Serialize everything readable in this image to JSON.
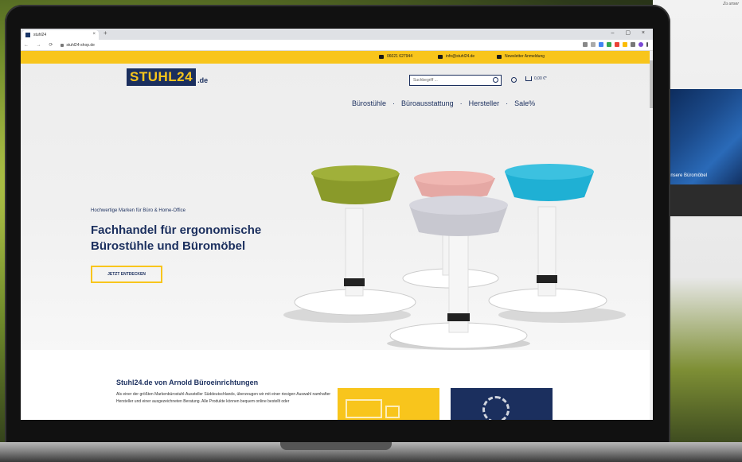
{
  "background": {
    "right_text": "Zu unser",
    "right_caption": "Unsere Büromöbel"
  },
  "browser": {
    "tab_title": "stuhl24",
    "url": "stuhl24-shop.de"
  },
  "topbar": {
    "phone": "06021 627944",
    "email": "info@stuhl24.de",
    "newsletter": "Newsletter Anmeldung"
  },
  "header": {
    "logo_main": "STUHL24",
    "logo_tld": ".de",
    "search_placeholder": "Suchbegriff ...",
    "cart_total": "0,00 €*"
  },
  "nav": {
    "items": [
      "Bürostühle",
      "Büroausstattung",
      "Hersteller",
      "Sale%"
    ]
  },
  "hero": {
    "kicker": "Hochwertige Marken für Büro & Home-Office",
    "headline": "Fachhandel für ergonomische Bürostühle und Büromöbel",
    "cta": "JETZT ENTDECKEN"
  },
  "content": {
    "title": "Stuhl24.de von Arnold Büroeinrichtungen",
    "text": "Als einer der größten Markenbürostuhl-Aussteller Süddeutschlands, überzeugen wir mit einer riesigen Auswahl namhafter Hersteller und einer ausgezeichneten Beratung. Alle Produkte können bequem online bestellt oder"
  },
  "colors": {
    "brand_yellow": "#f8c51c",
    "brand_navy": "#1b2f5e"
  }
}
